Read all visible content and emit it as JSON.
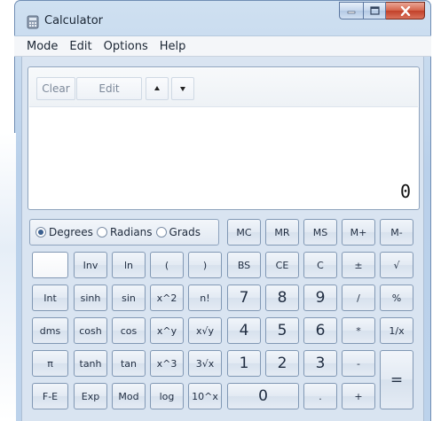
{
  "window": {
    "title": "Calculator"
  },
  "menu": [
    "Mode",
    "Edit",
    "Options",
    "Help"
  ],
  "history": {
    "clear_label": "Clear",
    "edit_label": "Edit"
  },
  "display": {
    "value": "0"
  },
  "angle_units": {
    "options": [
      "Degrees",
      "Radians",
      "Grads"
    ],
    "selected": "Degrees"
  },
  "memory_keys": [
    "MC",
    "MR",
    "MS",
    "M+",
    "M-"
  ],
  "rows": [
    [
      "",
      "Inv",
      "ln",
      "(",
      ")",
      "BS",
      "CE",
      "C",
      "±",
      "√"
    ],
    [
      "Int",
      "sinh",
      "sin",
      "x^2",
      "n!",
      "7",
      "8",
      "9",
      "/",
      "%"
    ],
    [
      "dms",
      "cosh",
      "cos",
      "x^y",
      "x√y",
      "4",
      "5",
      "6",
      "*",
      "1/x"
    ],
    [
      "π",
      "tanh",
      "tan",
      "x^3",
      "3√x",
      "1",
      "2",
      "3",
      "-",
      "="
    ],
    [
      "F-E",
      "Exp",
      "Mod",
      "log",
      "10^x",
      "0",
      ".",
      "+"
    ]
  ]
}
